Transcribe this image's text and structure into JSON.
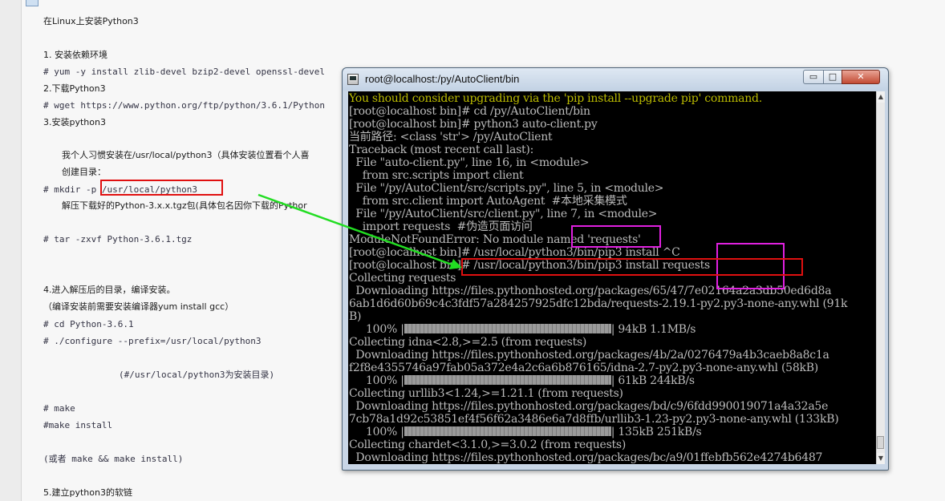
{
  "document": {
    "title_line": "在Linux上安装Python3",
    "lines": [
      "1. 安装依赖环境",
      "# yum -y install zlib-devel bzip2-devel openssl-devel",
      "2.下载Python3",
      "# wget https://www.python.org/ftp/python/3.6.1/Python",
      "3.安装python3",
      "我个人习惯安装在/usr/local/python3（具体安装位置看个人喜",
      "创建目录：",
      "# mkdir -p /usr/local/python3",
      "解压下载好的Python-3.x.x.tgz包(具体包名因你下载的Pythor",
      "# tar -zxvf Python-3.6.1.tgz",
      "4.进入解压后的目录，编译安装。",
      "（编译安装前需要安装编译器yum install gcc）",
      "# cd Python-3.6.1",
      "# ./configure --prefix=/usr/local/python3",
      "(#/usr/local/python3为安装目录)",
      "# make",
      "#make install",
      "(或者 make && make install)",
      "5.建立python3的软链"
    ]
  },
  "window": {
    "title": "root@localhost:/py/AutoClient/bin",
    "minimize_label": "▭",
    "maximize_label": "□",
    "close_label": "✕"
  },
  "terminal": {
    "lines": [
      "You should consider upgrading via the 'pip install --upgrade pip' command.",
      "[root@localhost bin]# cd /py/AutoClient/bin",
      "[root@localhost bin]# python3 auto-client.py",
      "当前路径: <class 'str'> /py/AutoClient",
      "Traceback (most recent call last):",
      "  File \"auto-client.py\", line 16, in <module>",
      "    from src.scripts import client",
      "  File \"/py/AutoClient/src/scripts.py\", line 5, in <module>",
      "    from src.client import AutoAgent  #本地采集模式",
      "  File \"/py/AutoClient/src/client.py\", line 7, in <module>",
      "    import requests  #伪造页面访问",
      "ModuleNotFoundError: No module named 'requests'",
      "[root@localhost bin]# /usr/local/python3/bin/pip3 install ^C",
      "[root@localhost bin]# /usr/local/python3/bin/pip3 install requests",
      "Collecting requests",
      "  Downloading https://files.pythonhosted.org/packages/65/47/7e02164a2a3db50ed6d8a",
      "6ab1d6d60b69c4c3fdf57a284257925dfc12bda/requests-2.19.1-py2.py3-none-any.whl (91k",
      "B)",
      "Collecting idna<2.8,>=2.5 (from requests)",
      "  Downloading https://files.pythonhosted.org/packages/4b/2a/0276479a4b3caeb8a8c1a",
      "f2f8e4355746a97fab05a372e4a2c6a6b876165/idna-2.7-py2.py3-none-any.whl (58kB)",
      "Collecting urllib3<1.24,>=1.21.1 (from requests)",
      "  Downloading https://files.pythonhosted.org/packages/bd/c9/6fdd990019071a4a32a5e",
      "7cb78a1d92c53851ef4f56f62a3486e6a7d8ffb/urllib3-1.23-py2.py3-none-any.whl (133kB)",
      "Collecting chardet<3.1.0,>=3.0.2 (from requests)",
      "  Downloading https://files.pythonhosted.org/packages/bc/a9/01ffebfb562e4274b6487"
    ],
    "progress": [
      {
        "percent_label": "100%",
        "fill": 1.0,
        "stats": "94kB 1.1MB/s"
      },
      {
        "percent_label": "100%",
        "fill": 1.0,
        "stats": "61kB 244kB/s"
      },
      {
        "percent_label": "100%",
        "fill": 1.0,
        "stats": "135kB 251kB/s"
      }
    ]
  },
  "colors": {
    "annotation_red": "#e01010",
    "annotation_magenta": "#e020e0",
    "arrow_green": "#22dd22",
    "terminal_bg": "#000000",
    "terminal_text": "#bbbbbb",
    "terminal_warning": "#bbbb00"
  }
}
